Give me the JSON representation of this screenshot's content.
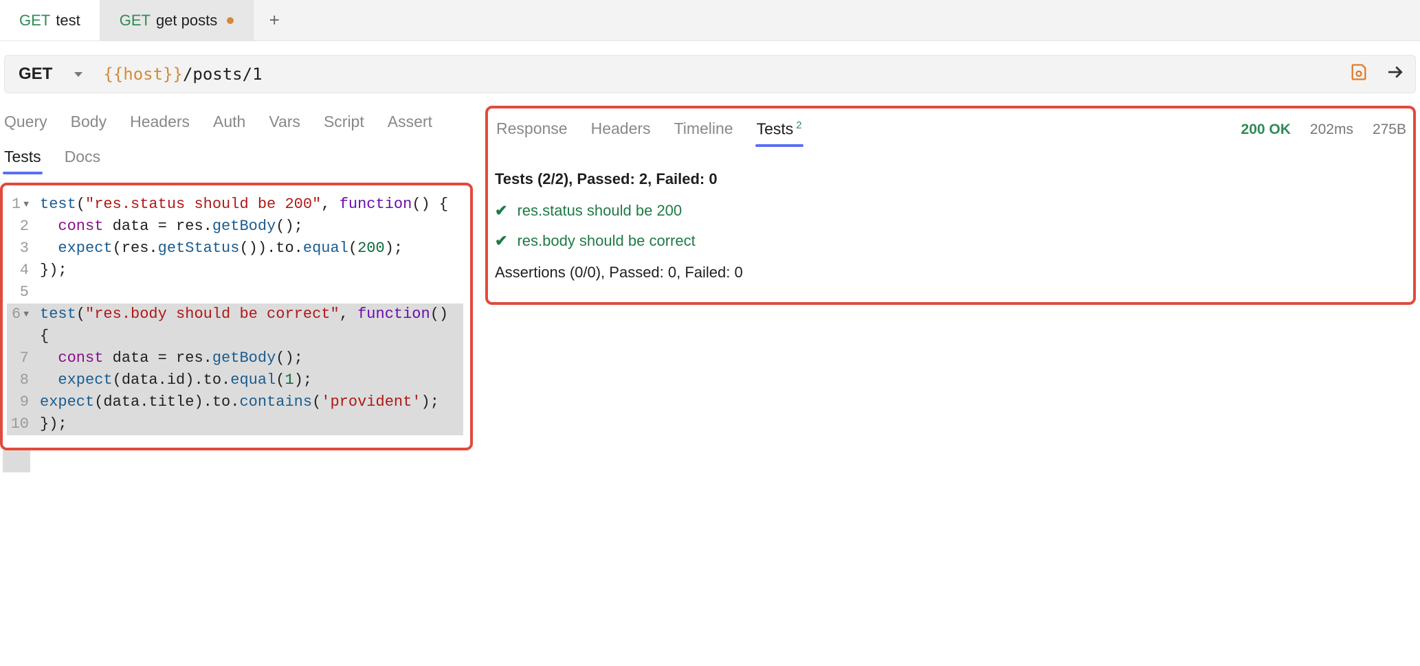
{
  "tabs": [
    {
      "method": "GET",
      "label": "test",
      "modified": false,
      "active": false
    },
    {
      "method": "GET",
      "label": "get posts",
      "modified": true,
      "active": true
    }
  ],
  "request": {
    "method": "GET",
    "url_var": "{{host}}",
    "url_path": "/posts/1"
  },
  "left_tabs_row1": [
    "Query",
    "Body",
    "Headers",
    "Auth",
    "Vars",
    "Script",
    "Assert"
  ],
  "left_tabs_row2": [
    "Tests",
    "Docs"
  ],
  "left_active_tab": "Tests",
  "right_tabs": [
    "Response",
    "Headers",
    "Timeline",
    "Tests"
  ],
  "right_active_tab": "Tests",
  "right_tests_badge": "2",
  "response_meta": {
    "status": "200 OK",
    "time": "202ms",
    "size": "275B"
  },
  "code_lines": [
    {
      "n": 1,
      "fold": true,
      "hl": false,
      "segs": [
        [
          "call",
          "test"
        ],
        [
          "",
          "("
        ],
        [
          "str",
          "\"res.status should be 200\""
        ],
        [
          "",
          ", "
        ],
        [
          "fn",
          "function"
        ],
        [
          "",
          "() {"
        ]
      ]
    },
    {
      "n": 2,
      "fold": false,
      "hl": false,
      "segs": [
        [
          "",
          "  "
        ],
        [
          "kw",
          "const"
        ],
        [
          "",
          " data = res."
        ],
        [
          "call",
          "getBody"
        ],
        [
          "",
          "();"
        ]
      ]
    },
    {
      "n": 3,
      "fold": false,
      "hl": false,
      "segs": [
        [
          "",
          "  "
        ],
        [
          "call",
          "expect"
        ],
        [
          "",
          "(res."
        ],
        [
          "call",
          "getStatus"
        ],
        [
          "",
          "()).to."
        ],
        [
          "call",
          "equal"
        ],
        [
          "",
          "("
        ],
        [
          "num",
          "200"
        ],
        [
          "",
          ");"
        ]
      ]
    },
    {
      "n": 4,
      "fold": false,
      "hl": false,
      "segs": [
        [
          "",
          "});"
        ]
      ]
    },
    {
      "n": 5,
      "fold": false,
      "hl": false,
      "segs": [
        [
          "",
          ""
        ]
      ]
    },
    {
      "n": 6,
      "fold": true,
      "hl": true,
      "segs": [
        [
          "call",
          "test"
        ],
        [
          "",
          "("
        ],
        [
          "str",
          "\"res.body should be correct\""
        ],
        [
          "",
          ", "
        ],
        [
          "fn",
          "function"
        ],
        [
          "",
          "() {"
        ]
      ]
    },
    {
      "n": 7,
      "fold": false,
      "hl": true,
      "segs": [
        [
          "",
          "  "
        ],
        [
          "kw",
          "const"
        ],
        [
          "",
          " data = res."
        ],
        [
          "call",
          "getBody"
        ],
        [
          "",
          "();"
        ]
      ]
    },
    {
      "n": 8,
      "fold": false,
      "hl": true,
      "segs": [
        [
          "",
          "  "
        ],
        [
          "call",
          "expect"
        ],
        [
          "",
          "(data.id).to."
        ],
        [
          "call",
          "equal"
        ],
        [
          "",
          "("
        ],
        [
          "num",
          "1"
        ],
        [
          "",
          ");"
        ]
      ]
    },
    {
      "n": 9,
      "fold": false,
      "hl": true,
      "segs": [
        [
          "call",
          "expect"
        ],
        [
          "",
          "(data.title).to."
        ],
        [
          "call",
          "contains"
        ],
        [
          "",
          "("
        ],
        [
          "str",
          "'provident'"
        ],
        [
          "",
          ");"
        ]
      ]
    },
    {
      "n": 10,
      "fold": false,
      "hl": true,
      "segs": [
        [
          "",
          "});"
        ]
      ]
    }
  ],
  "results": {
    "summary": "Tests (2/2), Passed: 2, Failed: 0",
    "passed": [
      "res.status should be 200",
      "res.body should be correct"
    ],
    "assertions": "Assertions (0/0), Passed: 0, Failed: 0"
  }
}
